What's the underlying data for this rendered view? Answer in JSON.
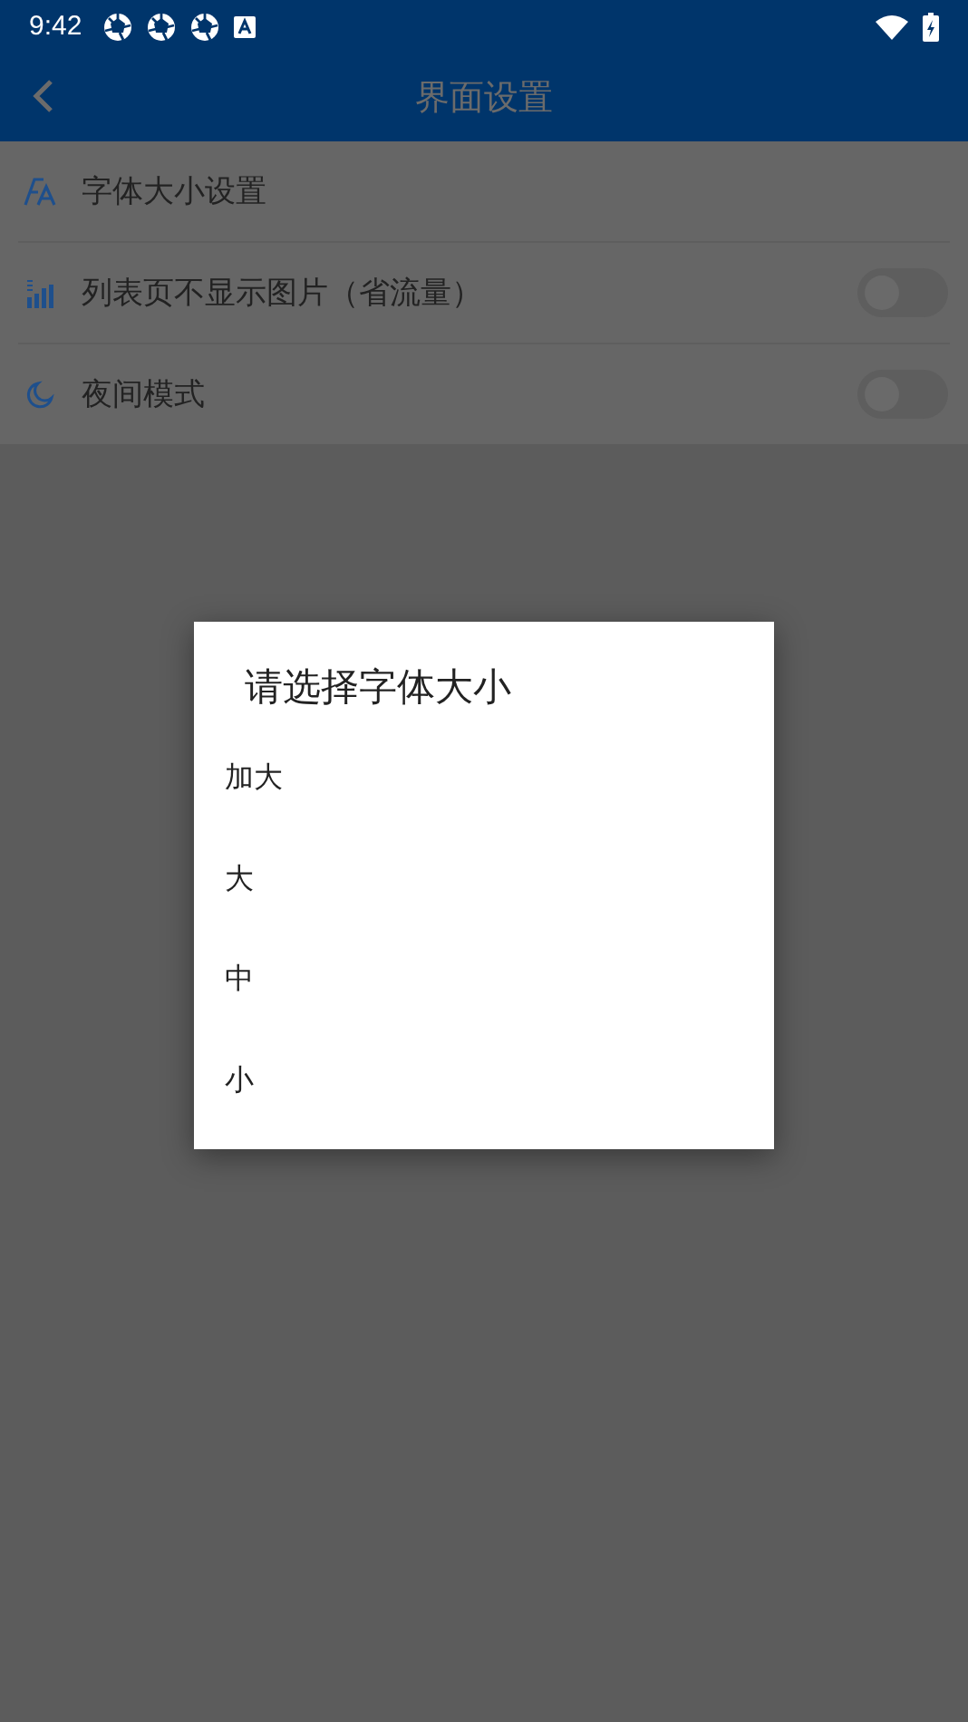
{
  "status_bar": {
    "time": "9:42"
  },
  "app_bar": {
    "title": "界面设置"
  },
  "settings": [
    {
      "kind": "link",
      "label": "字体大小设置"
    },
    {
      "kind": "toggle",
      "label": "列表页不显示图片（省流量）",
      "on": false
    },
    {
      "kind": "toggle",
      "label": "夜间模式",
      "on": false
    }
  ],
  "dialog": {
    "title": "请选择字体大小",
    "options": [
      {
        "label": "加大"
      },
      {
        "label": "大"
      },
      {
        "label": "中"
      },
      {
        "label": "小"
      }
    ]
  }
}
